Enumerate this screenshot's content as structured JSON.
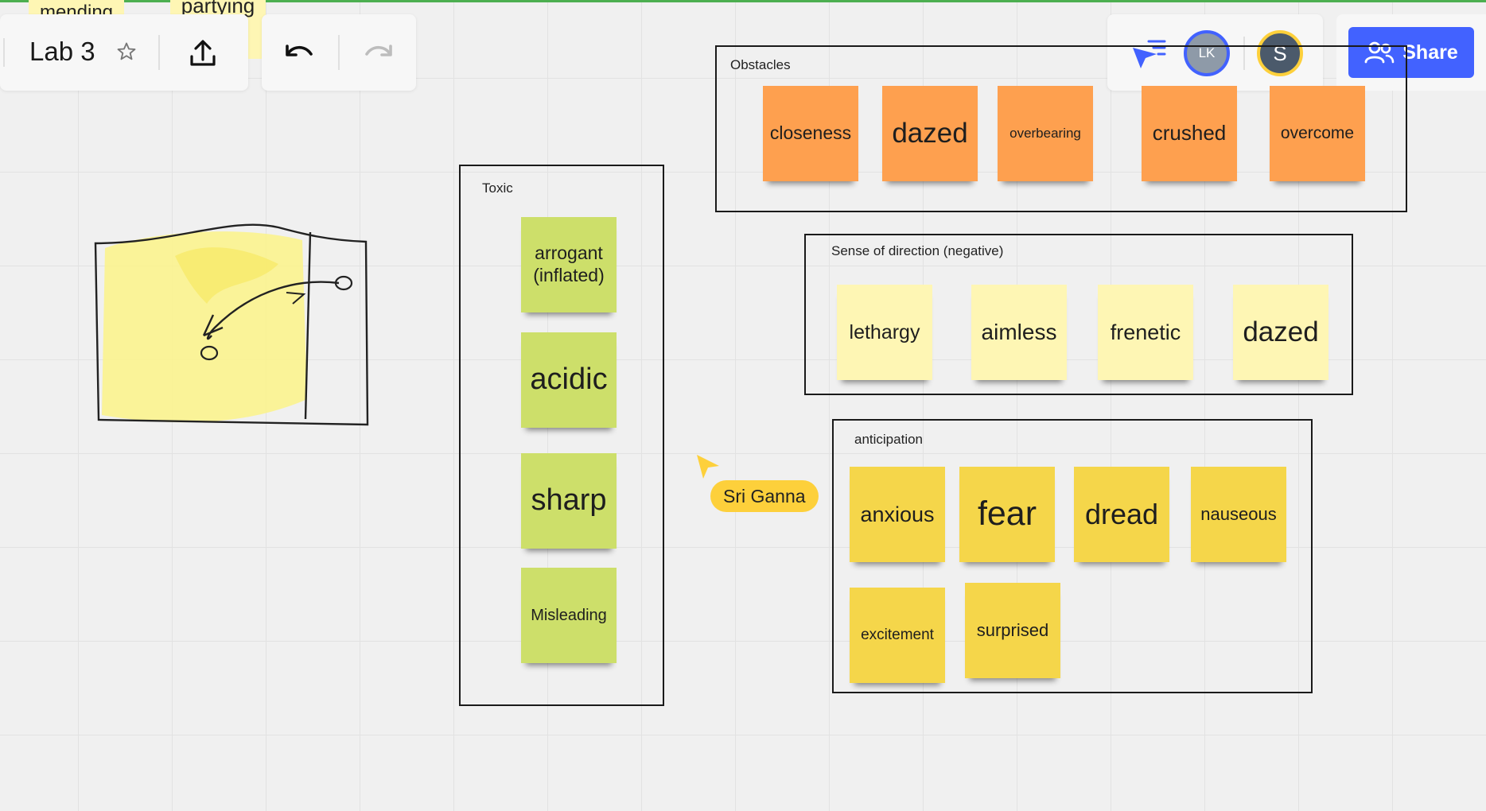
{
  "board": {
    "title": "Lab 3"
  },
  "peek": {
    "left_label": "mending",
    "right_label": "partying"
  },
  "collaborators": {
    "avatar1_initials": "LK",
    "avatar2_initials": "S"
  },
  "share": {
    "label": "Share"
  },
  "cursor": {
    "user_name": "Sri Ganna"
  },
  "frames": {
    "toxic": {
      "title": "Toxic",
      "notes": [
        "arrogant (inflated)",
        "acidic",
        "sharp",
        "Misleading"
      ]
    },
    "obstacles": {
      "title": "Obstacles",
      "notes": [
        "closeness",
        "dazed",
        "overbearing",
        "crushed",
        "overcome"
      ]
    },
    "direction": {
      "title": "Sense of direction (negative)",
      "notes": [
        "lethargy",
        "aimless",
        "frenetic",
        "dazed"
      ]
    },
    "anticipation": {
      "title": "anticipation",
      "notes": [
        "anxious",
        "fear",
        "dread",
        "nauseous",
        "excitement",
        "surprised"
      ]
    }
  },
  "colors": {
    "accent": "#4262ff",
    "cursor": "#fdd03b",
    "green_note": "#cddf6a",
    "orange_note": "#fea04f",
    "pale_note": "#fef6b4",
    "yellow_note": "#f5d64a"
  },
  "icons": [
    "star-icon",
    "export-icon",
    "undo-icon",
    "redo-icon",
    "reactions-pointer-icon",
    "people-icon",
    "cursor-arrow-icon"
  ]
}
